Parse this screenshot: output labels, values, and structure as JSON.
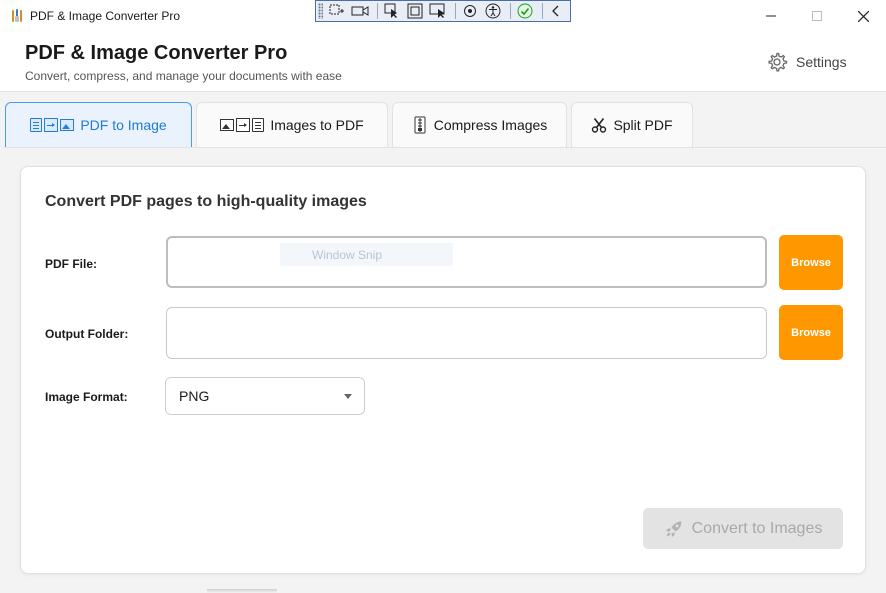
{
  "window": {
    "title": "PDF & Image Converter Pro",
    "controls": [
      "minimize-icon",
      "maximize-icon",
      "close-icon"
    ]
  },
  "snip_toolbar": {
    "tools": [
      "rect-snip-icon",
      "video-icon",
      "freeform-icon",
      "window-snip-icon",
      "fullscreen-snip-icon",
      "blur-icon",
      "accessibility-icon",
      "check-icon",
      "collapse-icon"
    ],
    "ghost_label": "Window Snip"
  },
  "header": {
    "title": "PDF & Image Converter Pro",
    "subtitle": "Convert, compress, and manage your documents with ease",
    "settings_label": "Settings"
  },
  "tabs": [
    {
      "label": "PDF to Image",
      "active": true,
      "icon": "pdf-to-image-icon"
    },
    {
      "label": "Images to PDF",
      "active": false,
      "icon": "images-to-pdf-icon"
    },
    {
      "label": "Compress Images",
      "active": false,
      "icon": "compress-icon"
    },
    {
      "label": "Split PDF",
      "active": false,
      "icon": "scissors-icon"
    }
  ],
  "form": {
    "heading": "Convert PDF pages to high-quality images",
    "pdf_file_label": "PDF File:",
    "pdf_file_value": "",
    "output_folder_label": "Output Folder:",
    "output_folder_value": "",
    "browse_label": "Browse",
    "image_format_label": "Image Format:",
    "image_format_value": "PNG",
    "convert_label": "Convert to Images",
    "convert_enabled": false
  },
  "colors": {
    "accent": "#1f7ad6",
    "browse": "#ff9800",
    "disabled": "#e3e3e3"
  }
}
